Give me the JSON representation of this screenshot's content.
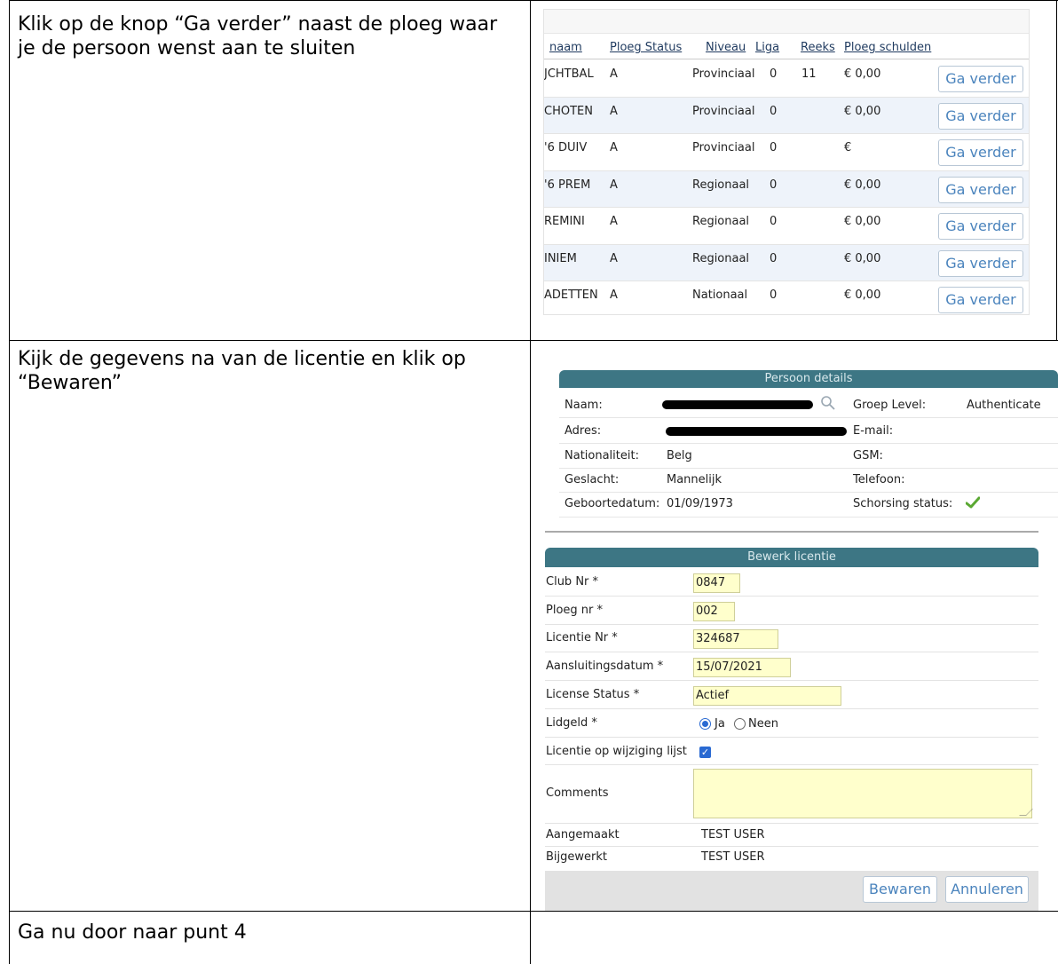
{
  "instructions": {
    "row1": "Klik op de knop “Ga verder” naast de ploeg waar je de persoon wenst aan te sluiten",
    "row2": "Kijk de gegevens na van de licentie en klik op “Bewaren”",
    "row3": "Ga nu door naar punt 4"
  },
  "team_list": {
    "headers": [
      "naam",
      "Ploeg Status",
      "Niveau",
      "Liga",
      "Reeks",
      "Ploeg schulden"
    ],
    "rows": [
      {
        "naam": "JCHTBAL",
        "status": "A",
        "niveau": "Provinciaal",
        "liga": "0",
        "reeks": "11",
        "schulden": "€ 0,00",
        "button": "Ga verder"
      },
      {
        "naam": "CHOTEN",
        "status": "A",
        "niveau": "Provinciaal",
        "liga": "0",
        "reeks": "",
        "schulden": "€ 0,00",
        "button": "Ga verder"
      },
      {
        "naam": "'6 DUIV",
        "status": "A",
        "niveau": "Provinciaal",
        "liga": "0",
        "reeks": "",
        "schulden": "€",
        "button": "Ga verder"
      },
      {
        "naam": "'6 PREM",
        "status": "A",
        "niveau": "Regionaal",
        "liga": "0",
        "reeks": "",
        "schulden": "€ 0,00",
        "button": "Ga verder"
      },
      {
        "naam": "REMINI",
        "status": "A",
        "niveau": "Regionaal",
        "liga": "0",
        "reeks": "",
        "schulden": "€ 0,00",
        "button": "Ga verder"
      },
      {
        "naam": "INIEM",
        "status": "A",
        "niveau": "Regionaal",
        "liga": "0",
        "reeks": "",
        "schulden": "€ 0,00",
        "button": "Ga verder"
      },
      {
        "naam": "ADETTEN",
        "status": "A",
        "niveau": "Nationaal",
        "liga": "0",
        "reeks": "",
        "schulden": "€ 0,00",
        "button": "Ga verder"
      }
    ]
  },
  "persoon_details": {
    "title": "Persoon details",
    "naam_label": "Naam:",
    "adres_label": "Adres:",
    "nationaliteit_label": "Nationaliteit:",
    "nationaliteit_value": "Belg",
    "geslacht_label": "Geslacht:",
    "geslacht_value": "Mannelijk",
    "geboortedatum_label": "Geboortedatum:",
    "geboortedatum_value": "01/09/1973",
    "groep_level_label": "Groep Level:",
    "groep_level_value": "Authenticate",
    "email_label": "E-mail:",
    "gsm_label": "GSM:",
    "telefoon_label": "Telefoon:",
    "schorsing_label": "Schorsing status:"
  },
  "bewerk_licentie": {
    "title": "Bewerk licentie",
    "club_nr_label": "Club Nr *",
    "club_nr_value": "0847",
    "ploeg_nr_label": "Ploeg nr *",
    "ploeg_nr_value": "002",
    "licentie_nr_label": "Licentie Nr *",
    "licentie_nr_value": "324687",
    "aansluitingsdatum_label": "Aansluitingsdatum *",
    "aansluitingsdatum_value": "15/07/2021",
    "license_status_label": "License Status *",
    "license_status_value": "Actief",
    "lidgeld_label": "Lidgeld *",
    "lidgeld_ja": "Ja",
    "lidgeld_neen": "Neen",
    "wijziging_label": "Licentie op wijziging lijst",
    "comments_label": "Comments",
    "aangemaakt_label": "Aangemaakt",
    "aangemaakt_value": "TEST USER",
    "bijgewerkt_label": "Bijgewerkt",
    "bijgewerkt_value": "TEST USER",
    "save_label": "Bewaren",
    "cancel_label": "Annuleren"
  },
  "colors": {
    "panel_header": "#3d7684",
    "button_text": "#4b84bd",
    "input_bg": "#ffffcc",
    "alt_row": "#eef3fa",
    "check_green": "#5aa832"
  }
}
